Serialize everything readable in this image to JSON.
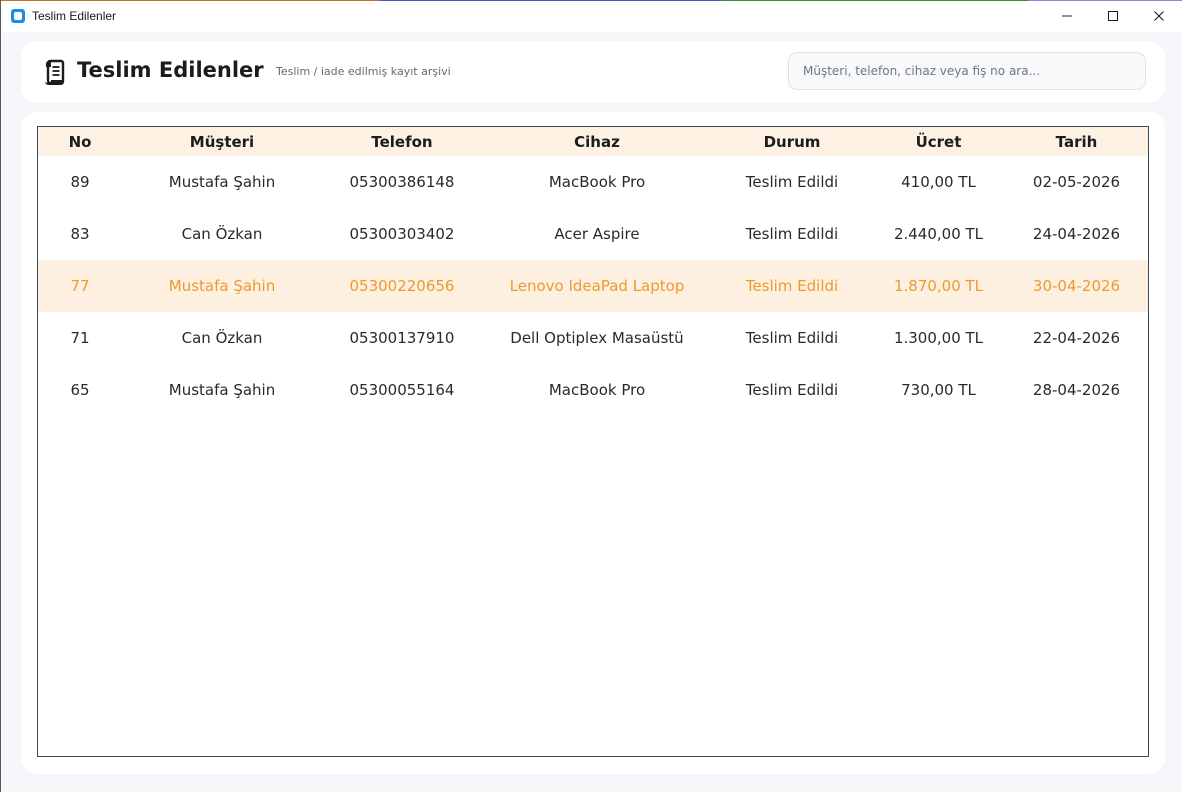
{
  "window": {
    "title": "Teslim Edilenler",
    "controls": [
      "minimize",
      "maximize",
      "close"
    ]
  },
  "header": {
    "title": "Teslim Edilenler",
    "subtitle": "Teslim / iade edilmiş kayıt arşivi",
    "icon": "scroll-icon",
    "search": {
      "placeholder": "Müşteri, telefon, cihaz veya fiş no ara...",
      "value": ""
    }
  },
  "table": {
    "columns": [
      "No",
      "Müşteri",
      "Telefon",
      "Cihaz",
      "Durum",
      "Ücret",
      "Tarih"
    ],
    "rows": [
      {
        "no": "89",
        "musteri": "Mustafa Şahin",
        "telefon": "05300386148",
        "cihaz": "MacBook Pro",
        "durum": "Teslim Edildi",
        "ucret": "410,00 TL",
        "tarih": "02-05-2026"
      },
      {
        "no": "83",
        "musteri": "Can Özkan",
        "telefon": "05300303402",
        "cihaz": "Acer Aspire",
        "durum": "Teslim Edildi",
        "ucret": "2.440,00 TL",
        "tarih": "24-04-2026"
      },
      {
        "no": "77",
        "musteri": "Mustafa Şahin",
        "telefon": "05300220656",
        "cihaz": "Lenovo IdeaPad Laptop",
        "durum": "Teslim Edildi",
        "ucret": "1.870,00 TL",
        "tarih": "30-04-2026"
      },
      {
        "no": "71",
        "musteri": "Can Özkan",
        "telefon": "05300137910",
        "cihaz": "Dell Optiplex Masaüstü",
        "durum": "Teslim Edildi",
        "ucret": "1.300,00 TL",
        "tarih": "22-04-2026"
      },
      {
        "no": "65",
        "musteri": "Mustafa Şahin",
        "telefon": "05300055164",
        "cihaz": "MacBook Pro",
        "durum": "Teslim Edildi",
        "ucret": "730,00 TL",
        "tarih": "28-04-2026"
      }
    ],
    "selected_row_index": 2
  },
  "colors": {
    "accent": "#ee9a2c",
    "header_bg": "#fdf1e3",
    "selected_bg": "#fdf0e1",
    "app_icon": "#1a8ee8"
  }
}
